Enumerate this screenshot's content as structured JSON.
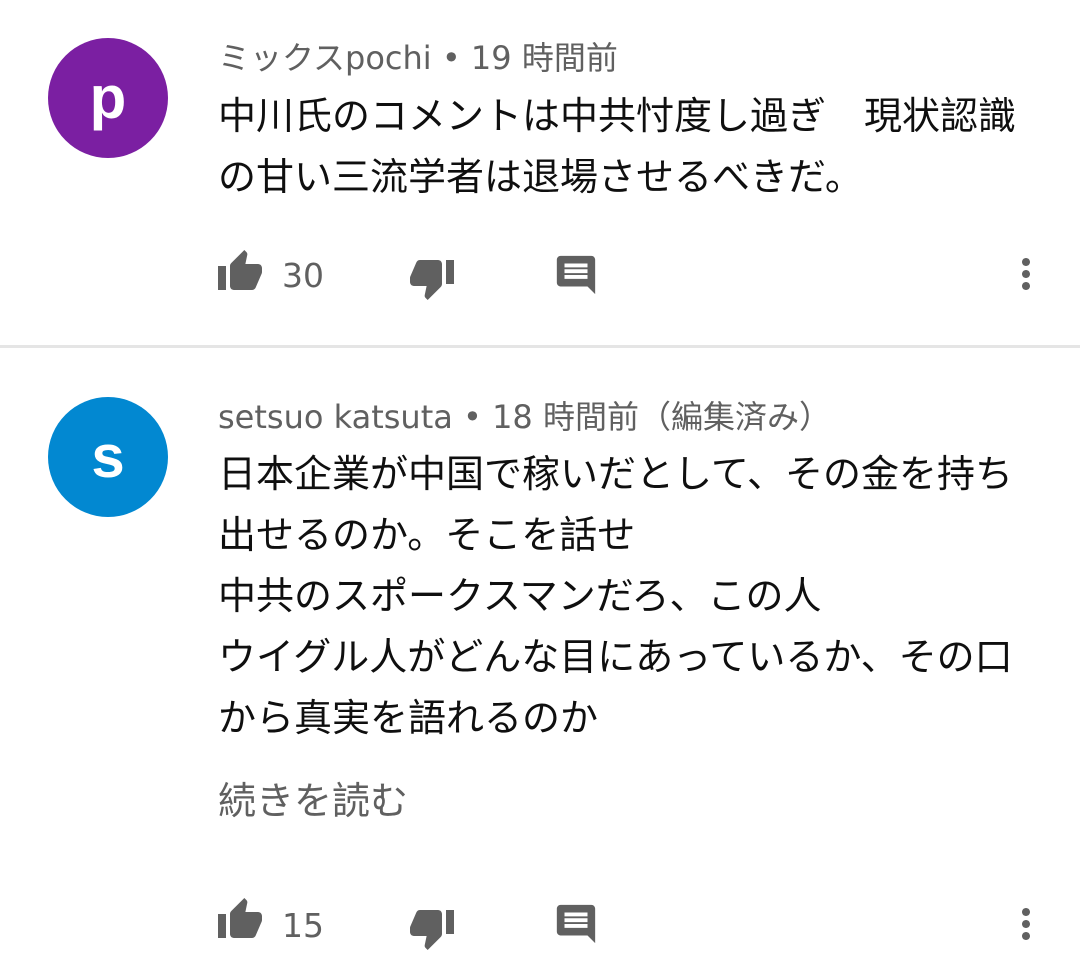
{
  "comments": [
    {
      "avatar_letter": "p",
      "avatar_color": "#7b1fa2",
      "author": "ミックスpochi",
      "separator": "•",
      "time": "19 時間前",
      "edited": "",
      "text": "中川氏のコメントは中共忖度し過ぎ　現状認識の甘い三流学者は退場させるべきだ。",
      "read_more": "",
      "likes": "30"
    },
    {
      "avatar_letter": "s",
      "avatar_color": "#0288d1",
      "author": "setsuo katsuta",
      "separator": "•",
      "time": "18 時間前",
      "edited": "（編集済み）",
      "text": "日本企業が中国で稼いだとして、その金を持ち出せるのか。そこを話せ\n中共のスポークスマンだろ、この人\nウイグル人がどんな目にあっているか、その口から真実を語れるのか",
      "read_more": "続きを読む",
      "likes": "15"
    }
  ],
  "icons": {
    "like": "thumb-up-icon",
    "dislike": "thumb-down-icon",
    "reply": "comment-icon",
    "more": "more-vert-icon"
  },
  "colors": {
    "icon": "#606060",
    "text": "#0f0f0f",
    "secondary_text": "#606060",
    "divider": "#e5e5e5"
  }
}
